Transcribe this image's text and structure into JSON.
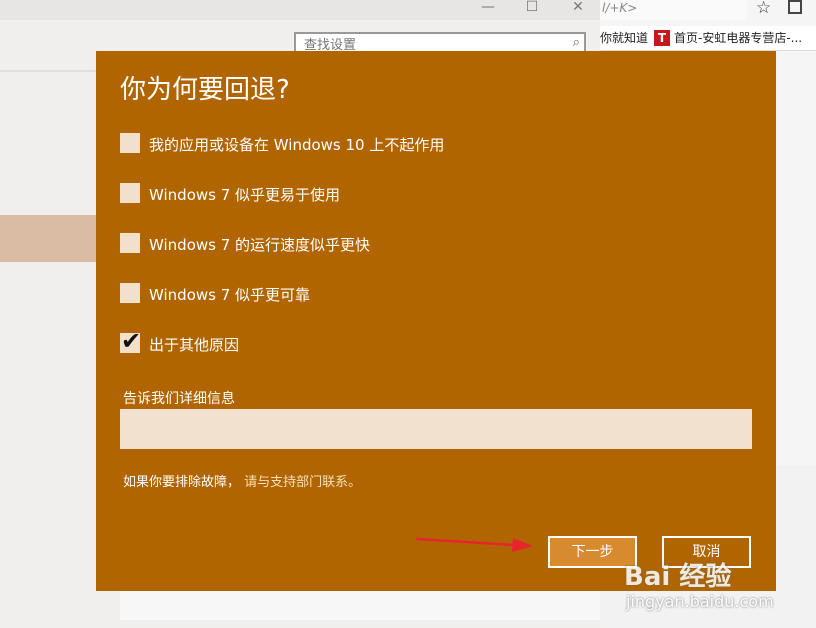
{
  "settings_window": {
    "search_placeholder": "查找设置",
    "search_icon": "search-icon",
    "minimize_glyph": "—",
    "maximize_glyph": "☐",
    "close_glyph": "✕"
  },
  "browser": {
    "address_fragment": "l/+K>",
    "bookmarks": [
      "你就知道",
      "首页-安虹电器专营店-..."
    ],
    "bookmark_logo": "T"
  },
  "dialog": {
    "title": "你为何要回退?",
    "options": [
      {
        "label": "我的应用或设备在 Windows 10 上不起作用",
        "checked": false
      },
      {
        "label": "Windows 7 似乎更易于使用",
        "checked": false
      },
      {
        "label": "Windows 7 的运行速度似乎更快",
        "checked": false
      },
      {
        "label": "Windows 7 似乎更可靠",
        "checked": false
      },
      {
        "label": "出于其他原因",
        "checked": true
      }
    ],
    "checkmark_glyph": "✔",
    "detail_label": "告诉我们详细信息",
    "detail_value": "",
    "troubleshoot_text": "如果你要排除故障，",
    "troubleshoot_link": "请与支持部门联系。",
    "next_button": "下一步",
    "cancel_button": "取消"
  },
  "watermark": {
    "main": "Bai 经验",
    "sub": "jingyan.baidu.com"
  },
  "colors": {
    "dialog_bg": "#b06500",
    "primary_button": "#d78b2e",
    "annotation_arrow": "#e8242c"
  }
}
